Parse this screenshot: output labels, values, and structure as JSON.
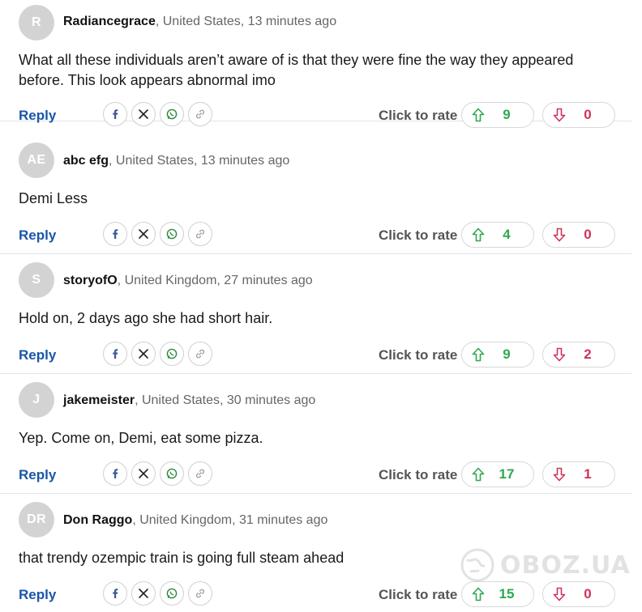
{
  "rate_label": "Click to rate",
  "reply_label": "Reply",
  "share_icons": [
    "facebook-icon",
    "x-icon",
    "whatsapp-icon",
    "link-icon"
  ],
  "colors": {
    "reply": "#1a56a8",
    "upvote": "#2fa84f",
    "downvote": "#d0335a",
    "avatar": "#d3d3d3"
  },
  "watermark": "OBOZ.UA",
  "comments": [
    {
      "initials": "R",
      "author": "Radiancegrace",
      "location_time": ", United States, 13 minutes ago",
      "text": "What all these individuals aren’t aware of is that they were fine the way they appeared before. This look appears abnormal imo",
      "up": "9",
      "down": "0"
    },
    {
      "initials": "AE",
      "author": "abc efg",
      "location_time": ", United States, 13 minutes ago",
      "text": "Demi Less",
      "up": "4",
      "down": "0"
    },
    {
      "initials": "S",
      "author": "storyofO",
      "location_time": ", United Kingdom, 27 minutes ago",
      "text": "Hold on, 2 days ago she had short hair.",
      "up": "9",
      "down": "2"
    },
    {
      "initials": "J",
      "author": "jakemeister",
      "location_time": ", United States, 30 minutes ago",
      "text": "Yep. Come on, Demi, eat some pizza.",
      "up": "17",
      "down": "1"
    },
    {
      "initials": "DR",
      "author": "Don Raggo",
      "location_time": ", United Kingdom, 31 minutes ago",
      "text": "that trendy ozempic train is going full steam ahead",
      "up": "15",
      "down": "0"
    }
  ]
}
